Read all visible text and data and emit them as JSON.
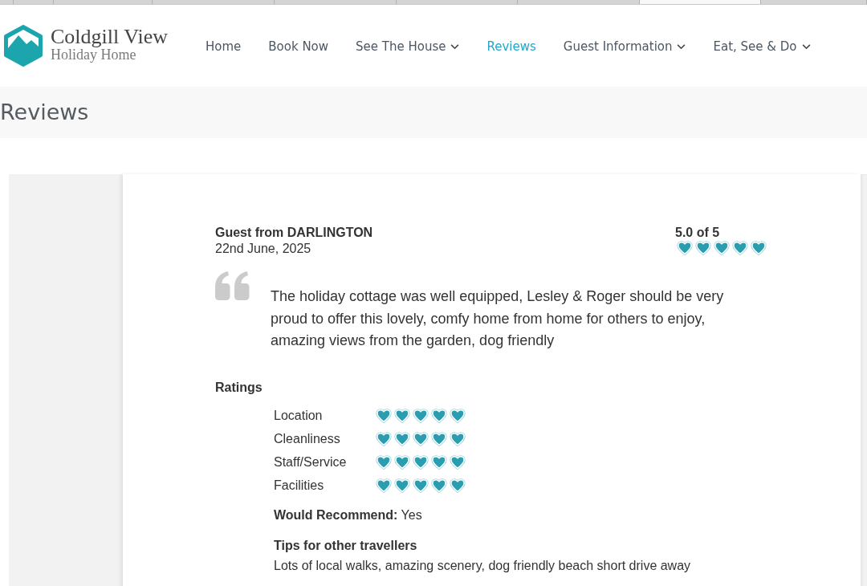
{
  "browser_tabs": [
    {
      "selected": false
    },
    {
      "selected": false
    },
    {
      "selected": false
    },
    {
      "selected": false
    },
    {
      "selected": false
    },
    {
      "selected": false
    },
    {
      "selected": false
    },
    {
      "selected": true
    },
    {
      "selected": false
    }
  ],
  "logo": {
    "name": "Coldgill View",
    "tagline": "Holiday Home"
  },
  "nav": [
    {
      "label": "Home",
      "selected": false,
      "dropdown": false
    },
    {
      "label": "Book Now",
      "selected": false,
      "dropdown": false
    },
    {
      "label": "See The House",
      "selected": false,
      "dropdown": true
    },
    {
      "label": "Reviews",
      "selected": true,
      "dropdown": false
    },
    {
      "label": "Guest Information",
      "selected": false,
      "dropdown": true
    },
    {
      "label": "Eat, See & Do",
      "selected": false,
      "dropdown": true
    }
  ],
  "page_title": "Reviews",
  "review": {
    "guest": "Guest from DARLINGTON",
    "date": "22nd June, 2025",
    "score": "5.0 of 5",
    "stars": 5,
    "text": "The holiday cottage was well equipped, Lesley & Roger should be very proud to offer this lovely, comfy home from home for others to enjoy, amazing views from the garden, dog friendly",
    "ratings_heading": "Ratings",
    "ratings": [
      {
        "label": "Location",
        "stars": 5
      },
      {
        "label": "Cleanliness",
        "stars": 5
      },
      {
        "label": "Staff/Service",
        "stars": 5
      },
      {
        "label": "Facilities",
        "stars": 5
      }
    ],
    "recommend": "**Would Recommend:** Yes",
    "tips_heading": "Tips for other travellers",
    "tips": "Lots of local walks, amazing scenery, dog friendly beach short drive away"
  }
}
